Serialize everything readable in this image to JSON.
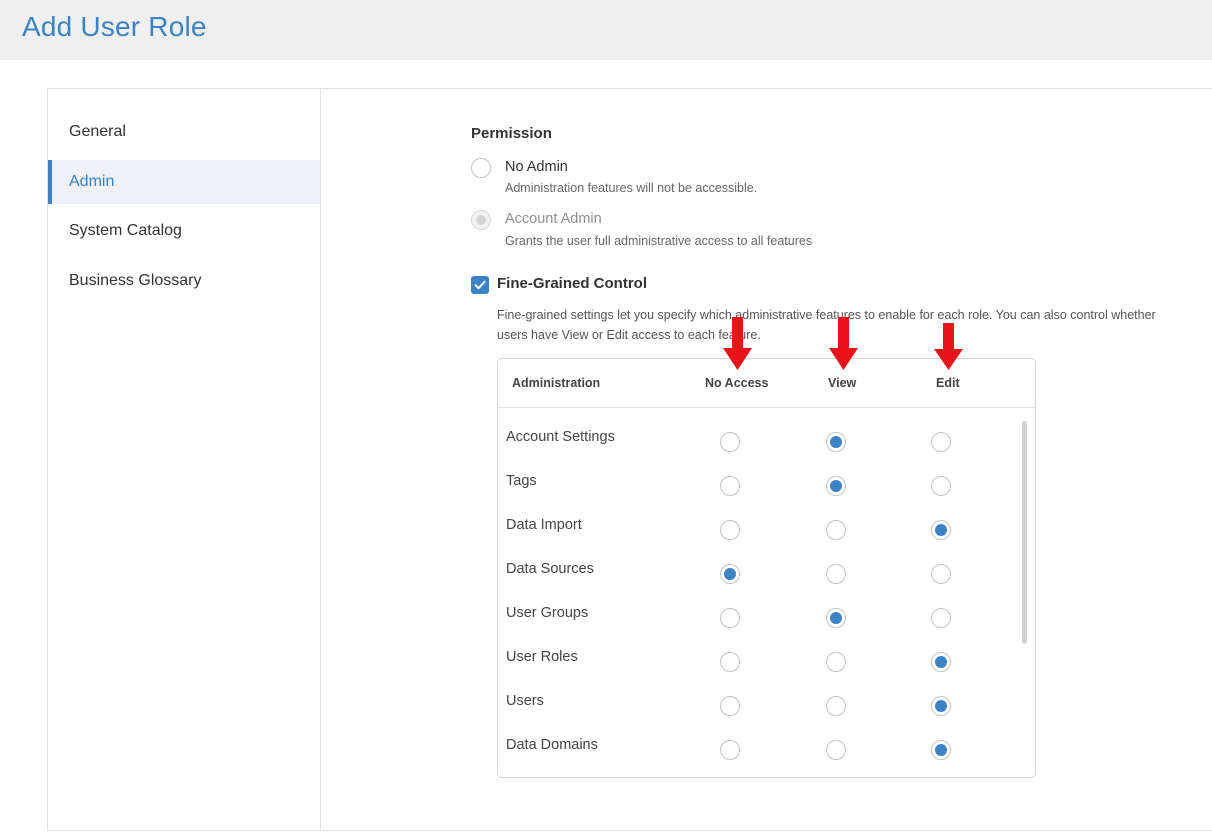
{
  "page": {
    "title": "Add User Role"
  },
  "sidebar": {
    "items": [
      {
        "label": "General",
        "active": false
      },
      {
        "label": "Admin",
        "active": true
      },
      {
        "label": "System Catalog",
        "active": false
      },
      {
        "label": "Business Glossary",
        "active": false
      }
    ]
  },
  "permission": {
    "label": "Permission",
    "options": [
      {
        "title": "No Admin",
        "description": "Administration features will not be accessible.",
        "state": "unselected"
      },
      {
        "title": "Account Admin",
        "description": "Grants the user full administrative access to all features",
        "state": "disabled"
      }
    ]
  },
  "fine_grained": {
    "label": "Fine-Grained Control",
    "checked": true,
    "description": "Fine-grained settings let you specify which administrative features to enable for each role. You can also control whether users have View or Edit access to each feature."
  },
  "table": {
    "headers": [
      "Administration",
      "No Access",
      "View",
      "Edit"
    ],
    "rows": [
      {
        "label": "Account Settings",
        "selected": "View"
      },
      {
        "label": "Tags",
        "selected": "View"
      },
      {
        "label": "Data Import",
        "selected": "Edit"
      },
      {
        "label": "Data Sources",
        "selected": "No Access"
      },
      {
        "label": "User Groups",
        "selected": "View"
      },
      {
        "label": "User Roles",
        "selected": "Edit"
      },
      {
        "label": "Users",
        "selected": "Edit"
      },
      {
        "label": "Data Domains",
        "selected": "Edit"
      }
    ]
  },
  "annotations": {
    "arrow_color": "#e8141a"
  },
  "colors": {
    "accent": "#3b83c4",
    "header_bg": "#efefef",
    "active_nav_bg": "#eef1f6"
  }
}
